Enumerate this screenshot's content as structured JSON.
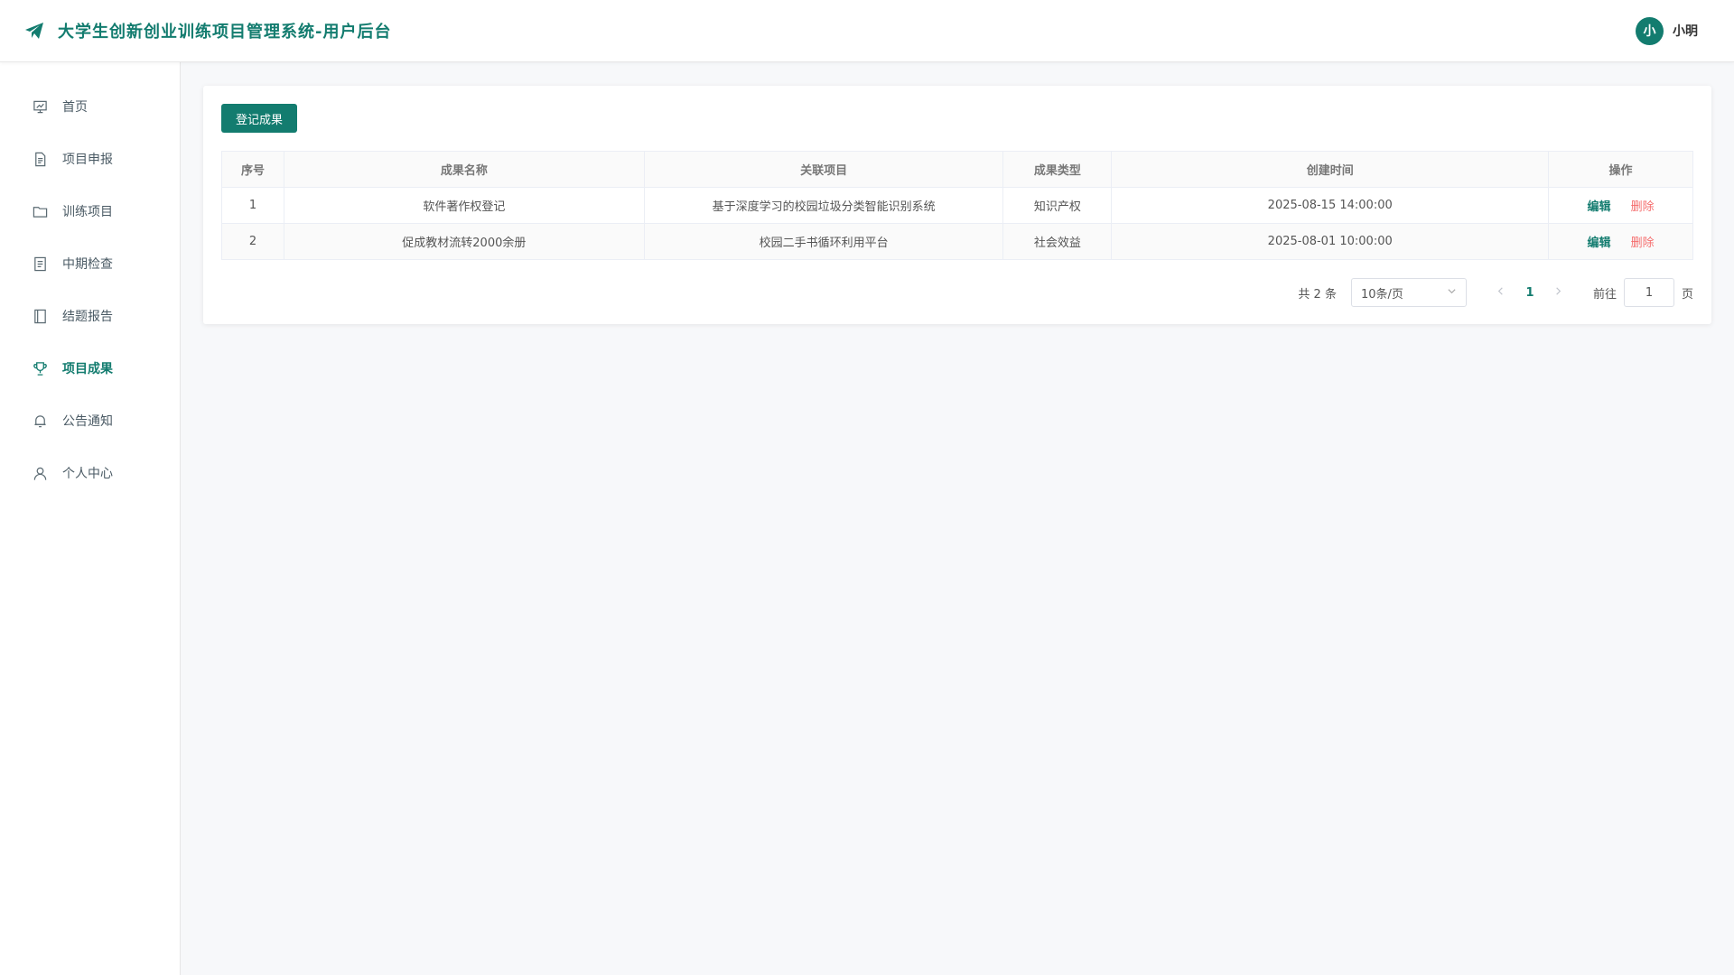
{
  "app": {
    "title": "大学生创新创业训练项目管理系统-用户后台",
    "logo_icon": "paper-plane-icon",
    "accent": "#137c6f"
  },
  "user": {
    "avatar_text": "小",
    "name": "小明"
  },
  "sidebar": {
    "items": [
      {
        "label": "首页",
        "icon": "presentation-icon",
        "active": false
      },
      {
        "label": "项目申报",
        "icon": "document-icon",
        "active": false
      },
      {
        "label": "训练项目",
        "icon": "folder-icon",
        "active": false
      },
      {
        "label": "中期检查",
        "icon": "checklist-icon",
        "active": false
      },
      {
        "label": "结题报告",
        "icon": "notebook-icon",
        "active": false
      },
      {
        "label": "项目成果",
        "icon": "trophy-icon",
        "active": true
      },
      {
        "label": "公告通知",
        "icon": "bell-icon",
        "active": false
      },
      {
        "label": "个人中心",
        "icon": "user-icon",
        "active": false
      }
    ]
  },
  "toolbar": {
    "register_label": "登记成果"
  },
  "table": {
    "headers": [
      "序号",
      "成果名称",
      "关联项目",
      "成果类型",
      "创建时间",
      "操作"
    ],
    "rows": [
      {
        "index": "1",
        "name": "软件著作权登记",
        "project": "基于深度学习的校园垃圾分类智能识别系统",
        "type": "知识产权",
        "created": "2025-08-15 14:00:00"
      },
      {
        "index": "2",
        "name": "促成教材流转2000余册",
        "project": "校园二手书循环利用平台",
        "type": "社会效益",
        "created": "2025-08-01 10:00:00"
      }
    ],
    "edit_label": "编辑",
    "delete_label": "删除"
  },
  "pagination": {
    "total_text": "共 2 条",
    "page_size": "10条/页",
    "current_page": "1",
    "jump_label": "前往",
    "jump_value": "1",
    "page_unit": "页"
  }
}
